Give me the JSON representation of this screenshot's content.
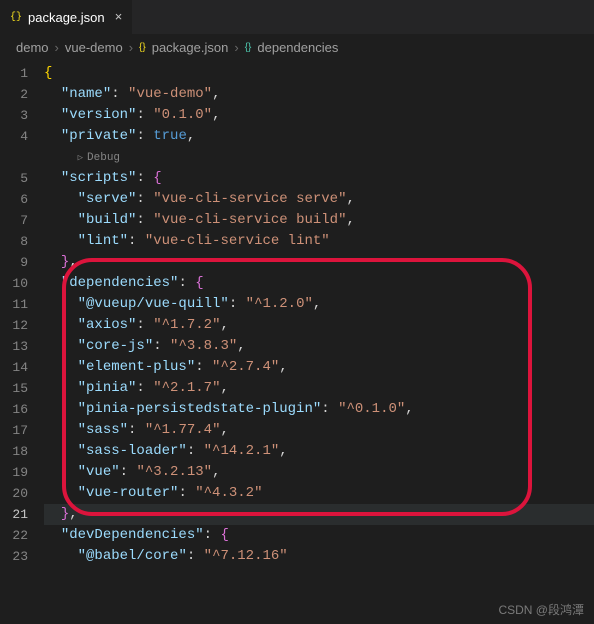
{
  "tab": {
    "filename": "package.json",
    "close": "×"
  },
  "breadcrumb": {
    "parts": [
      "demo",
      "vue-demo",
      "package.json",
      "dependencies"
    ],
    "sep": "›"
  },
  "debug_label": "Debug",
  "code": {
    "name": "vue-demo",
    "version": "0.1.0",
    "private_val": "true",
    "scripts": {
      "serve": "vue-cli-service serve",
      "build": "vue-cli-service build",
      "lint": "vue-cli-service lint"
    },
    "dependencies": {
      "@vueup/vue-quill": "^1.2.0",
      "axios": "^1.7.2",
      "core-js": "^3.8.3",
      "element-plus": "^2.7.4",
      "pinia": "^2.1.7",
      "pinia-persistedstate-plugin": "^0.1.0",
      "sass": "^1.77.4",
      "sass-loader": "^14.2.1",
      "vue": "^3.2.13",
      "vue-router": "^4.3.2"
    },
    "devDeps_label": "devDependencies",
    "babel_partial": "@babel/core",
    "babel_version_partial": "^7.12.16"
  },
  "line_numbers": [
    "1",
    "2",
    "3",
    "4",
    "5",
    "6",
    "7",
    "8",
    "9",
    "10",
    "11",
    "12",
    "13",
    "14",
    "15",
    "16",
    "17",
    "18",
    "19",
    "20",
    "21",
    "22",
    "23"
  ],
  "active_line": 21,
  "watermark": "CSDN @段鸿潭"
}
